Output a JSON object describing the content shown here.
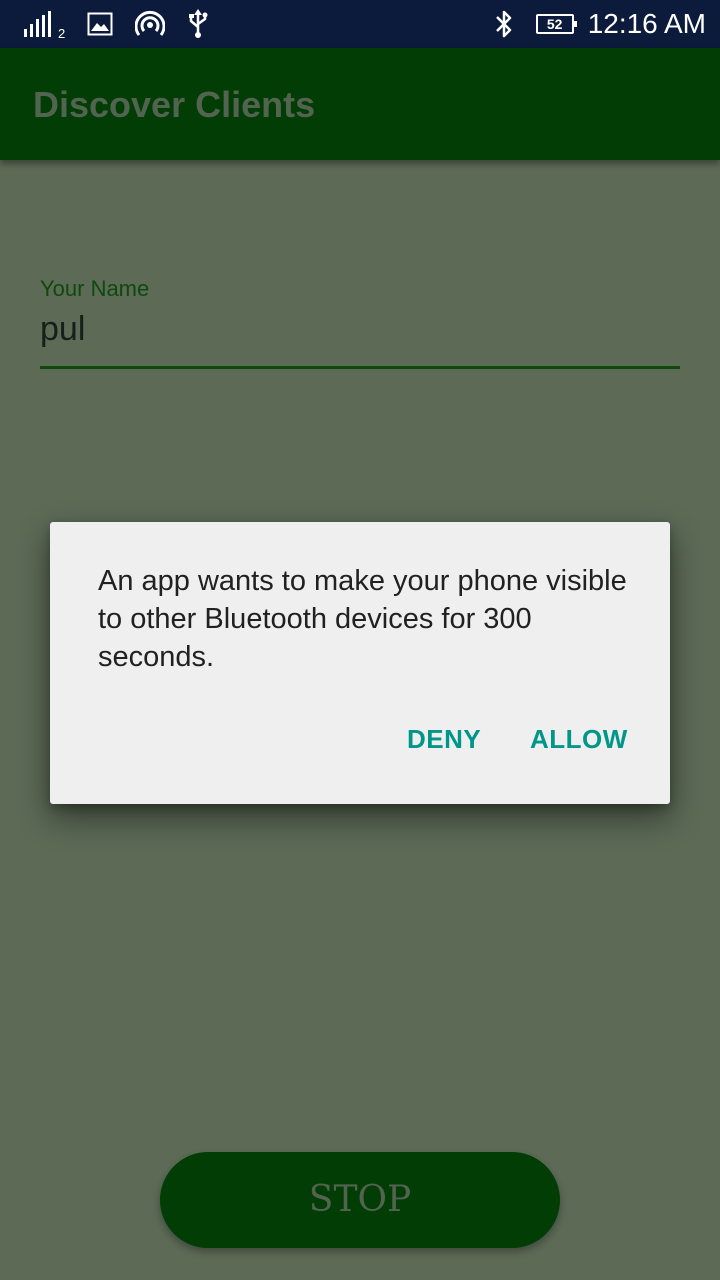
{
  "status_bar": {
    "sim_slot": "2",
    "battery_level": "52",
    "time": "12:16 AM",
    "icons": [
      "signal-icon",
      "image-icon",
      "hotspot-icon",
      "usb-icon",
      "bluetooth-icon",
      "battery-icon"
    ]
  },
  "app_bar": {
    "title": "Discover Clients"
  },
  "form": {
    "name_label": "Your Name",
    "name_value": "pul"
  },
  "dialog": {
    "message": "An app wants to make your phone visible to other Bluetooth devices for 300 seconds.",
    "deny_label": "DENY",
    "allow_label": "ALLOW"
  },
  "stop_button": {
    "label": "STOP"
  },
  "colors": {
    "status_bar": "#0c1a3c",
    "app_bar": "#013d04",
    "scrim_background": "#5c6a56",
    "dialog_background": "#efefef",
    "dialog_button": "#00968a"
  }
}
